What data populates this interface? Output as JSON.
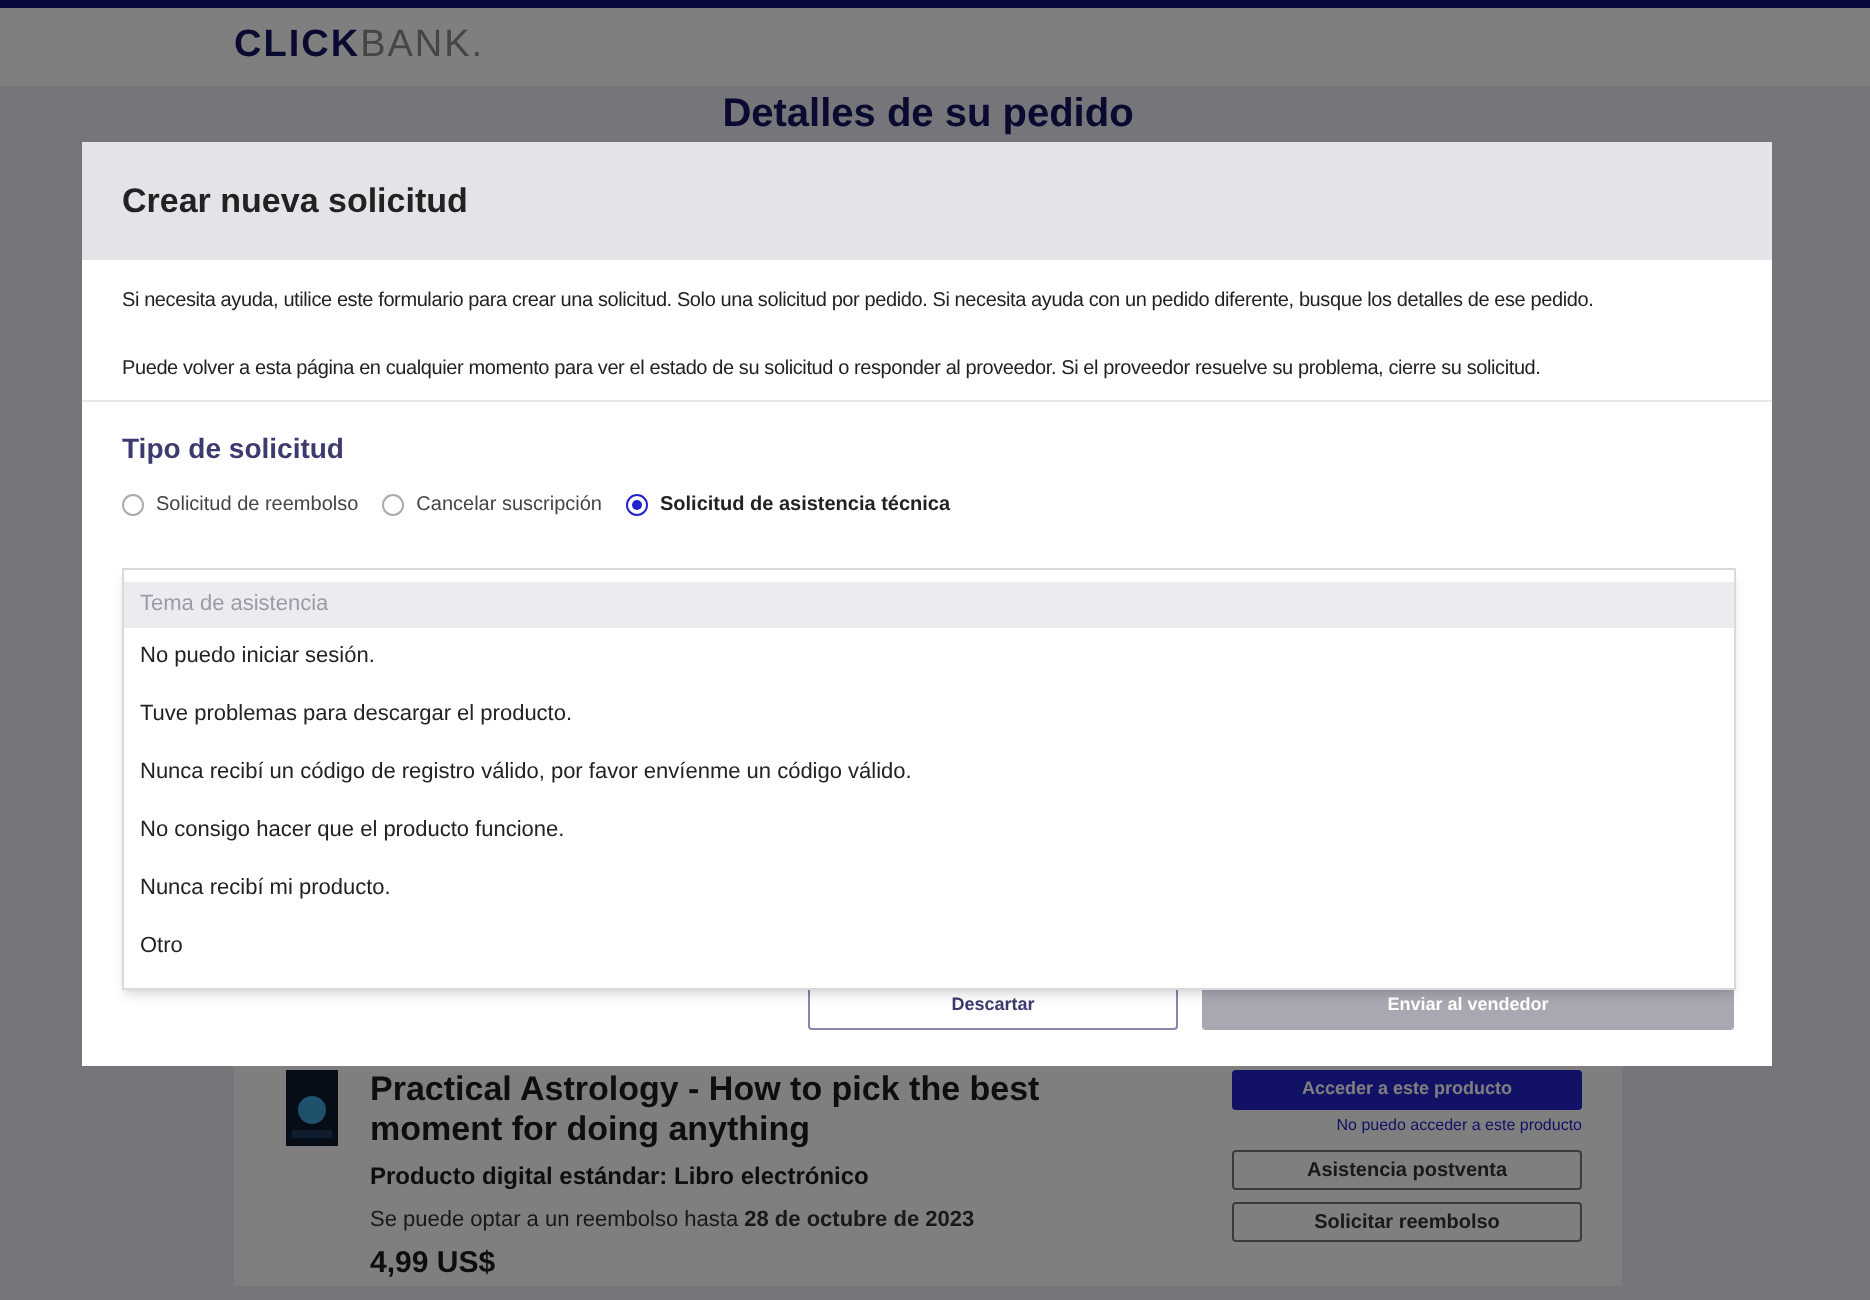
{
  "header": {
    "logo_bold": "CLICK",
    "logo_light": "BANK."
  },
  "page_title": "Detalles de su pedido",
  "product": {
    "title": "Practical Astrology - How to pick the best moment for doing anything",
    "type": "Producto digital estándar: Libro electrónico",
    "refund_note": "Se puede optar a un reembolso hasta **28 de octubre de 2023**",
    "price": "4,99 US$",
    "access_button": "Acceder a este producto",
    "access_link": "No puedo acceder a este producto",
    "buttons": [
      "Asistencia postventa",
      "Solicitar reembolso"
    ]
  },
  "modal": {
    "title": "Crear nueva solicitud",
    "paragraphs": [
      "Si necesita ayuda, utilice este formulario para crear una solicitud. Solo una solicitud por pedido. Si necesita ayuda con un pedido diferente, busque los detalles de ese pedido.",
      "Puede volver a esta página en cualquier momento para ver el estado de su solicitud o responder al proveedor. Si el proveedor resuelve su problema, cierre su solicitud."
    ],
    "section_title": "Tipo de solicitud",
    "radios": [
      {
        "label": "Solicitud de reembolso",
        "selected": false
      },
      {
        "label": "Cancelar suscripción",
        "selected": false
      },
      {
        "label": "Solicitud de asistencia técnica",
        "selected": true
      }
    ],
    "dropdown": {
      "placeholder": "Tema de asistencia",
      "options": [
        "No puedo iniciar sesión.",
        "Tuve problemas para descargar el producto.",
        "Nunca recibí un código de registro válido, por favor envíenme un código válido.",
        "No consigo hacer que el producto funcione.",
        "Nunca recibí mi producto.",
        "Otro"
      ]
    },
    "buttons": [
      {
        "label": "Descartar",
        "disabled": false
      },
      {
        "label": "Enviar al vendedor",
        "disabled": true
      }
    ]
  }
}
